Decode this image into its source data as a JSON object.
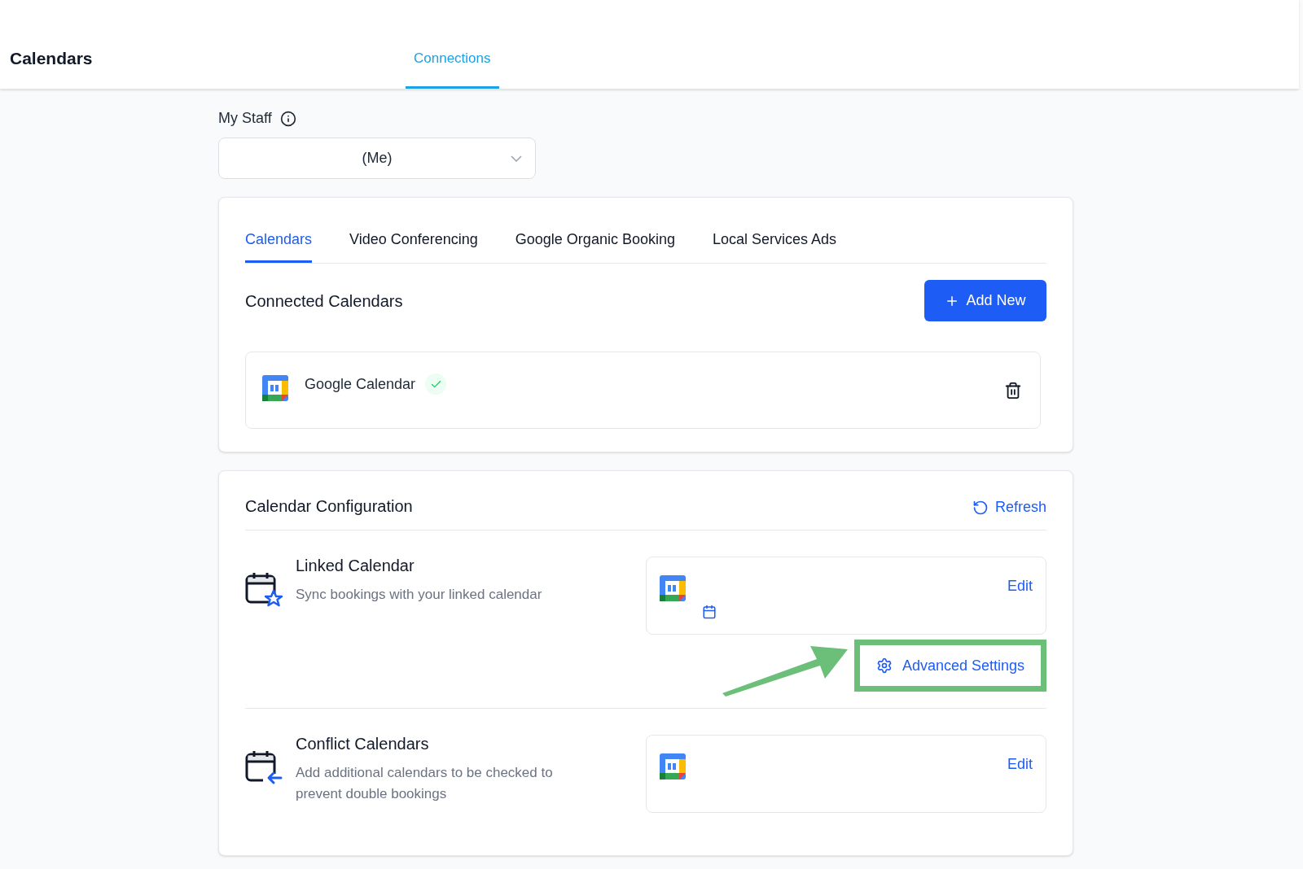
{
  "header": {
    "title": "Calendars",
    "tabs": [
      {
        "label": "Connections",
        "selected": true
      }
    ]
  },
  "staff": {
    "label": "My Staff",
    "value": "(Me)"
  },
  "connections_card": {
    "tabs": [
      {
        "label": "Calendars",
        "selected": true
      },
      {
        "label": "Video Conferencing",
        "selected": false
      },
      {
        "label": "Google Organic Booking",
        "selected": false
      },
      {
        "label": "Local Services Ads",
        "selected": false
      }
    ],
    "heading": "Connected Calendars",
    "add_button": "Add New",
    "calendars": [
      {
        "name": "Google Calendar",
        "connected": true
      }
    ]
  },
  "configuration": {
    "heading": "Calendar Configuration",
    "refresh": "Refresh",
    "sections": [
      {
        "kind": "linked",
        "title": "Linked Calendar",
        "description": "Sync bookings with your linked calendar",
        "edit": "Edit",
        "advanced": "Advanced Settings",
        "highlighted": true
      },
      {
        "kind": "conflict",
        "title": "Conflict Calendars",
        "description": "Add additional calendars to be checked to prevent double bookings",
        "edit": "Edit"
      }
    ]
  }
}
